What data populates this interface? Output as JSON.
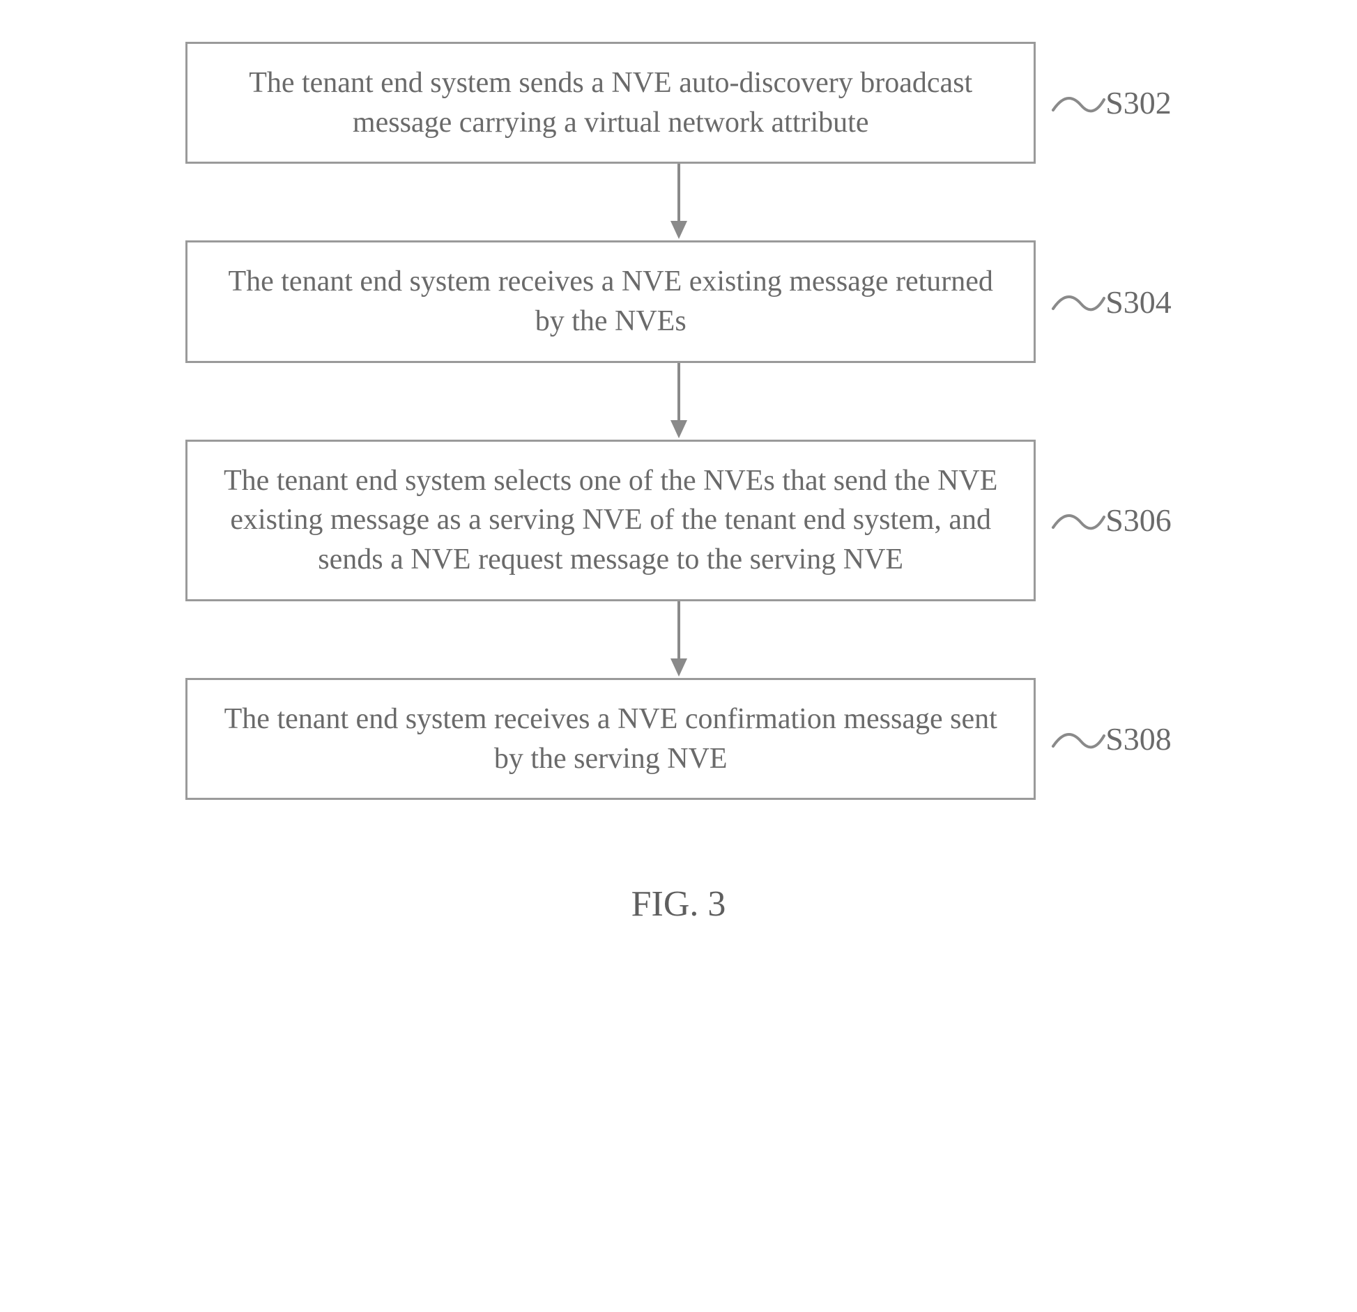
{
  "steps": [
    {
      "text": "The tenant end system sends a NVE auto-discovery broadcast message carrying a virtual network attribute",
      "label": "S302"
    },
    {
      "text": "The tenant end system receives a NVE existing message returned by the NVEs",
      "label": "S304"
    },
    {
      "text": "The tenant end system selects one of the NVEs that send the NVE existing message as a serving NVE of the tenant end system, and sends a NVE request message to the serving NVE",
      "label": "S306"
    },
    {
      "text": "The tenant end system receives a NVE confirmation message sent by the serving NVE",
      "label": "S308"
    }
  ],
  "figure_caption": "FIG. 3"
}
